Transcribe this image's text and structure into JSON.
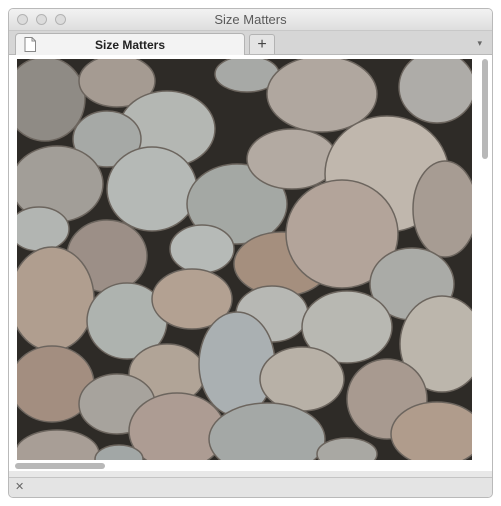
{
  "window": {
    "title": "Size Matters"
  },
  "tabs": [
    {
      "label": "Size Matters",
      "icon": "document-icon"
    }
  ],
  "new_tab_label": "+",
  "tab_menu_glyph": "▾",
  "status_bar": {
    "close_glyph": "✕"
  },
  "colors": {
    "background": "#2e2b27",
    "stone_light": "#b6b6b0",
    "stone_warm": "#b39a86"
  }
}
